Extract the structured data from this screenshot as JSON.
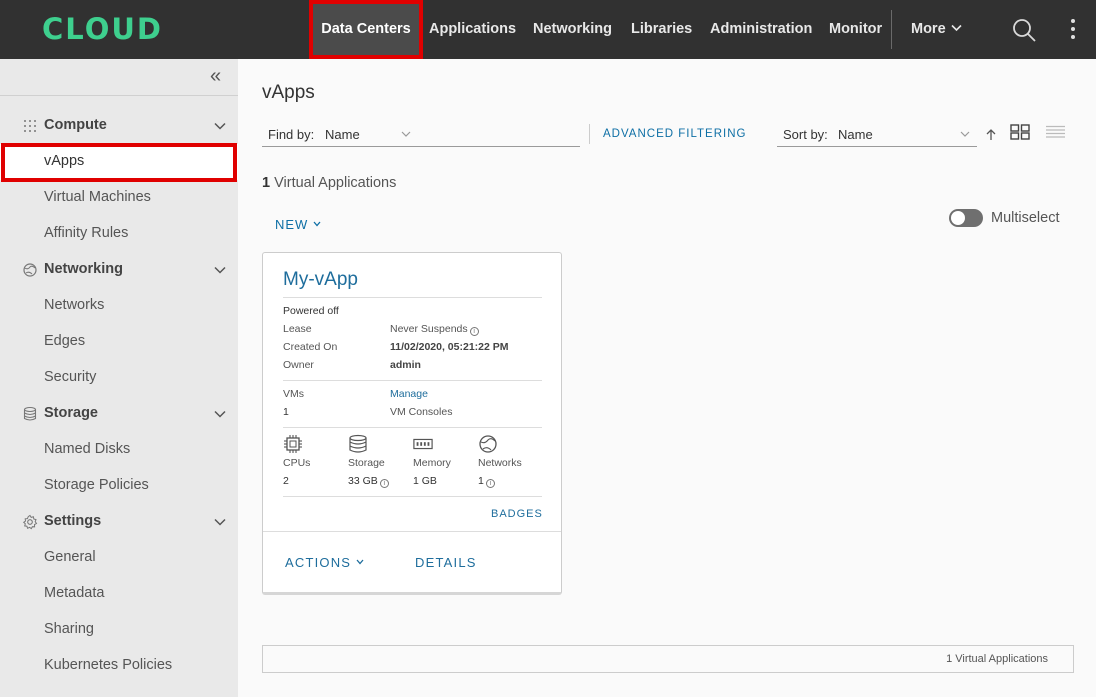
{
  "header": {
    "logo": "CLOUD",
    "nav": [
      "Data Centers",
      "Applications",
      "Networking",
      "Libraries",
      "Administration",
      "Monitor"
    ],
    "more_label": "More",
    "active_nav": "Data Centers"
  },
  "sidebar": {
    "sections": [
      {
        "label": "Compute",
        "icon": "compute-grid-icon",
        "items": [
          "vApps",
          "Virtual Machines",
          "Affinity Rules"
        ]
      },
      {
        "label": "Networking",
        "icon": "networking-globe-icon",
        "items": [
          "Networks",
          "Edges",
          "Security"
        ]
      },
      {
        "label": "Storage",
        "icon": "storage-database-icon",
        "items": [
          "Named Disks",
          "Storage Policies"
        ]
      },
      {
        "label": "Settings",
        "icon": "settings-gear-icon",
        "items": [
          "General",
          "Metadata",
          "Sharing",
          "Kubernetes Policies"
        ]
      }
    ],
    "selected_item": "vApps"
  },
  "main": {
    "title": "vApps",
    "find_by_label": "Find by:",
    "find_by_value": "Name",
    "advanced_filtering": "ADVANCED FILTERING",
    "sort_by_label": "Sort by:",
    "sort_by_value": "Name",
    "count_number": "1",
    "count_text": "Virtual Applications",
    "new_label": "NEW",
    "multiselect_label": "Multiselect",
    "multiselect_on": false
  },
  "card": {
    "name": "My-vApp",
    "status": "Powered off",
    "lease_label": "Lease",
    "lease_value": "Never Suspends",
    "created_label": "Created On",
    "created_value": "11/02/2020, 05:21:22 PM",
    "owner_label": "Owner",
    "owner_value": "admin",
    "vms_label": "VMs",
    "vms_value": "1",
    "manage_link": "Manage",
    "vm_consoles": "VM Consoles",
    "resources": [
      {
        "label": "CPUs",
        "value": "2",
        "icon": "cpu-icon",
        "info": false
      },
      {
        "label": "Storage",
        "value": "33 GB",
        "icon": "storage-icon",
        "info": true
      },
      {
        "label": "Memory",
        "value": "1 GB",
        "icon": "memory-icon",
        "info": false
      },
      {
        "label": "Networks",
        "value": "1",
        "icon": "network-icon",
        "info": true
      }
    ],
    "badges_label": "BADGES",
    "actions_label": "ACTIONS",
    "details_label": "DETAILS"
  },
  "footer": {
    "count_text": "1 Virtual Applications"
  },
  "colors": {
    "header_bg": "#313131",
    "logo": "#3ecf8e",
    "link": "#0e6fa5",
    "highlight": "#e00000",
    "sidebar_bg": "#e9e9e9"
  }
}
